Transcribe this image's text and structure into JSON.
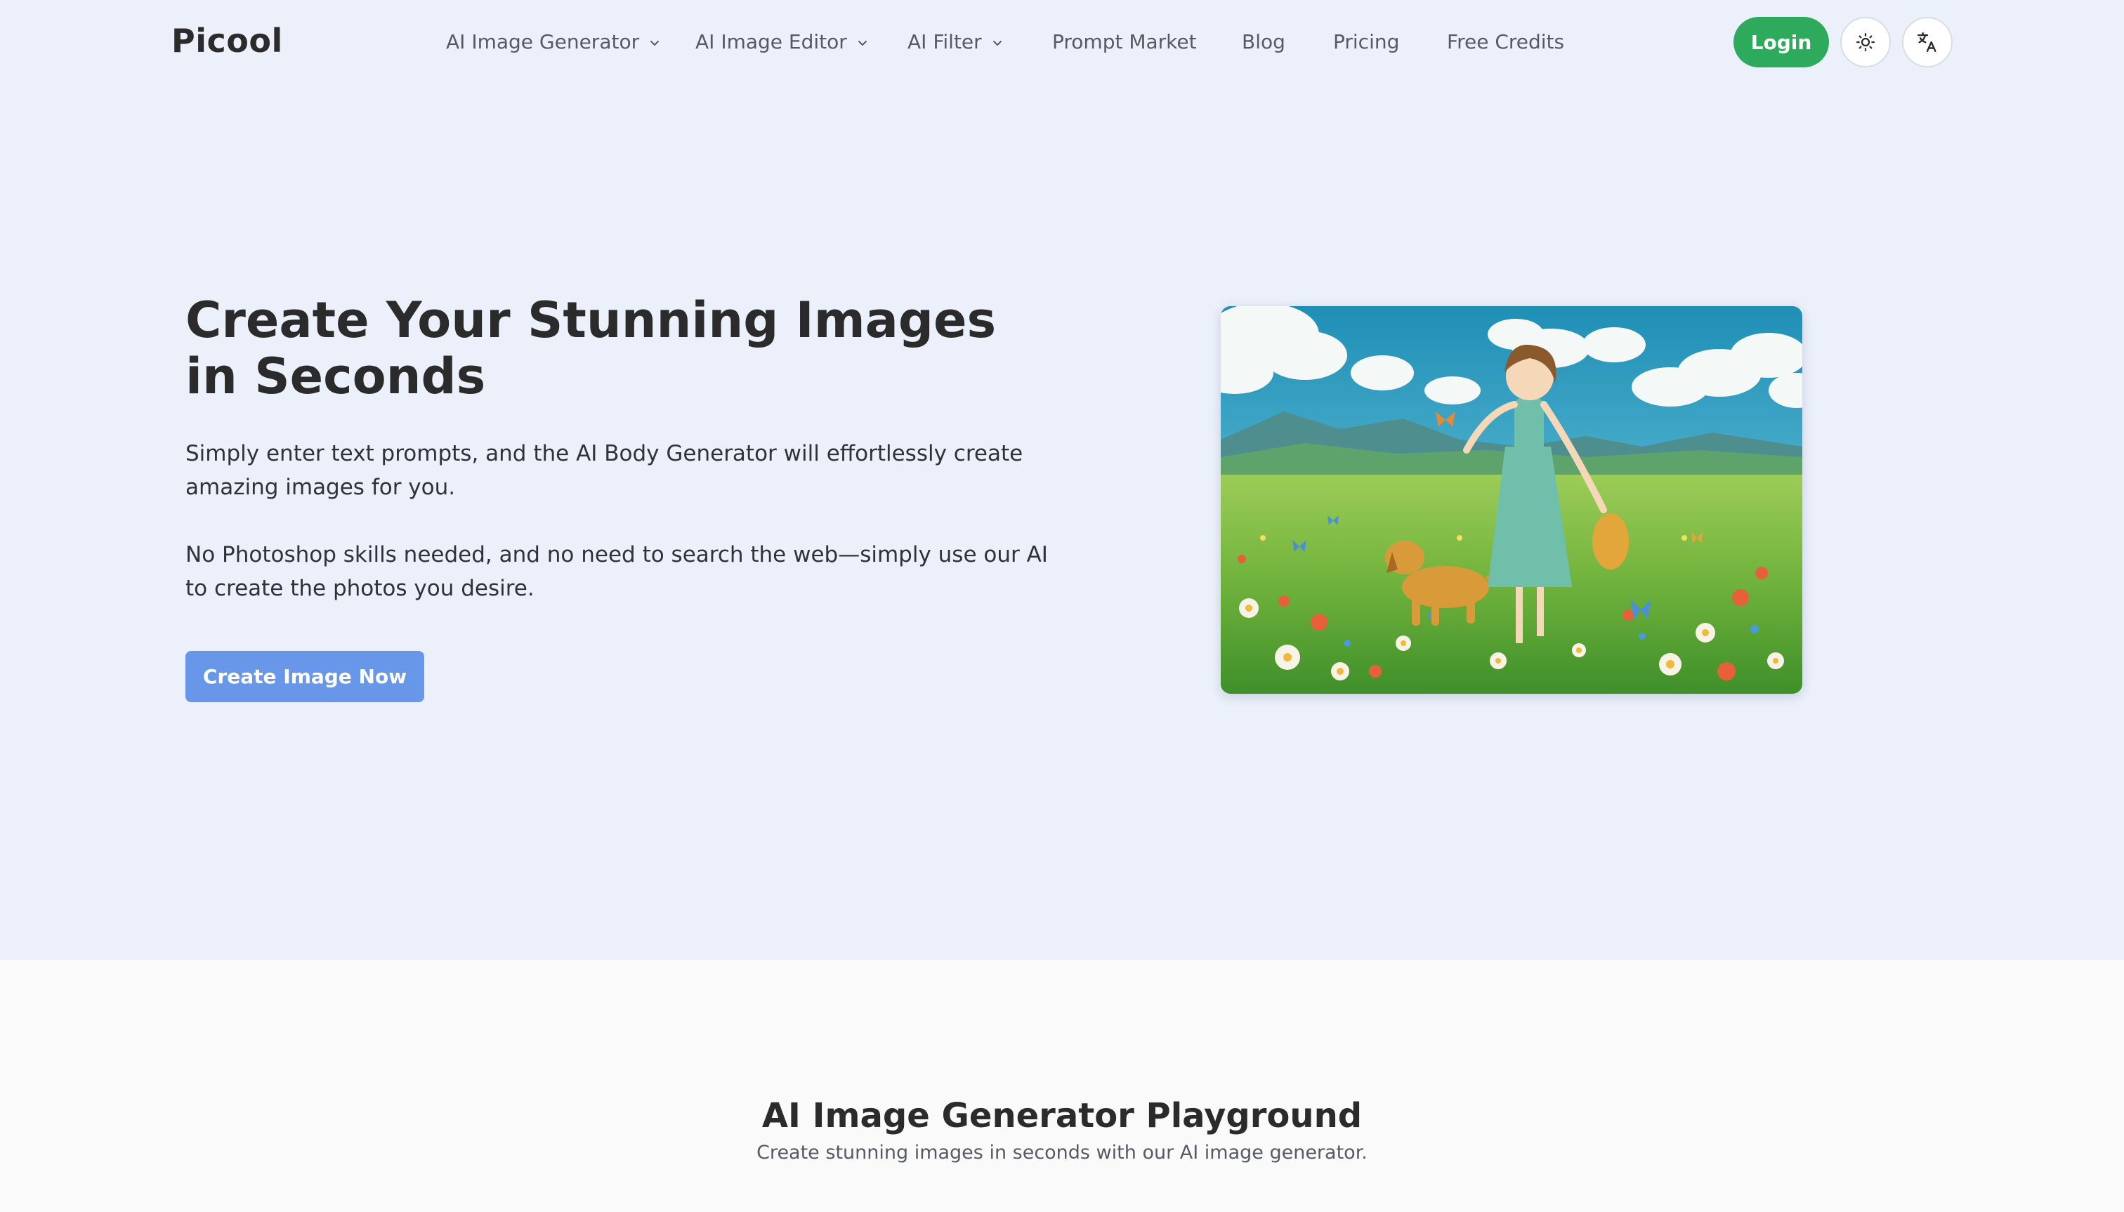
{
  "brand": {
    "logo": "Picool"
  },
  "nav": {
    "items": [
      {
        "label": "AI Image Generator",
        "has_dropdown": true
      },
      {
        "label": "AI Image Editor",
        "has_dropdown": true
      },
      {
        "label": "AI Filter",
        "has_dropdown": true
      },
      {
        "label": "Prompt Market",
        "has_dropdown": false
      },
      {
        "label": "Blog",
        "has_dropdown": false
      },
      {
        "label": "Pricing",
        "has_dropdown": false
      },
      {
        "label": "Free Credits",
        "has_dropdown": false
      }
    ],
    "login_label": "Login",
    "icons": {
      "theme": "sun-icon",
      "language": "translate-icon",
      "dropdown": "chevron-down-icon"
    }
  },
  "hero": {
    "title": "Create Your Stunning Images in Seconds",
    "paragraph_1": "Simply enter text prompts, and the AI Body Generator will effortlessly create amazing images for you.",
    "paragraph_2": "No Photoshop skills needed, and no need to search the web—simply use our AI to create the photos you desire.",
    "cta_label": "Create Image Now"
  },
  "playground": {
    "title": "AI Image Generator Playground",
    "subtitle": "Create stunning images in seconds with our AI image generator."
  },
  "colors": {
    "top_background": "#ebf0fa",
    "page_background": "#fafafa",
    "login_green": "#2eaa5c",
    "cta_blue": "#6896e8",
    "text_dark": "#2b2b2b",
    "text_muted": "#555a63"
  }
}
